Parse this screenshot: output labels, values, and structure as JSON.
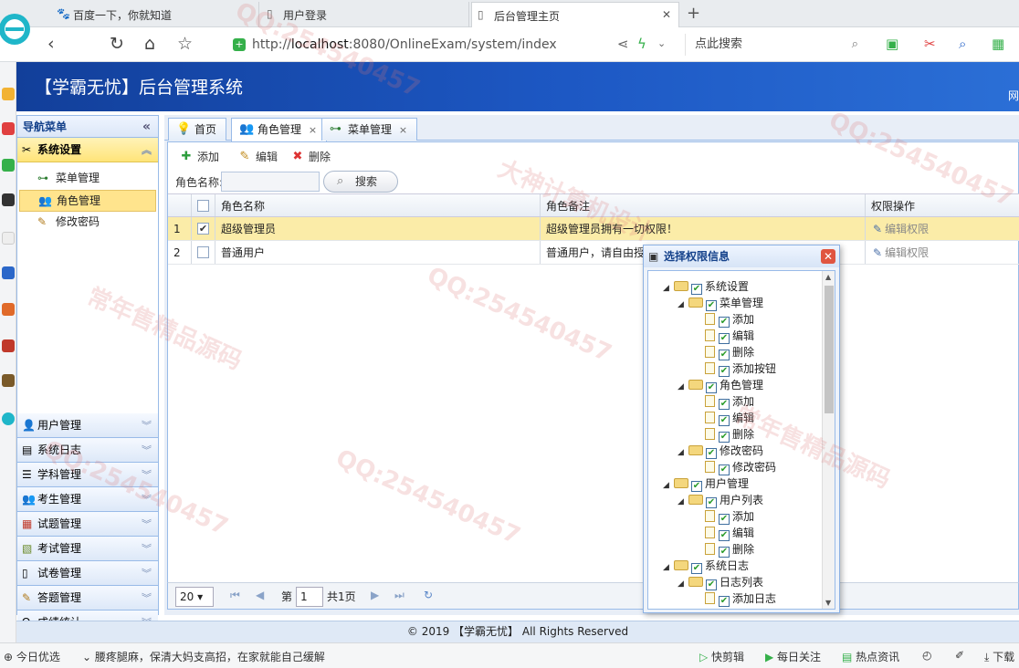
{
  "browser": {
    "tabs": [
      {
        "label": "百度一下，你就知道"
      },
      {
        "label": "用户登录"
      },
      {
        "label": "后台管理主页",
        "close": "✕"
      }
    ],
    "new_tab": "+",
    "url_scheme": "http://",
    "url_host": "localhost",
    "url_rest": ":8080/OnlineExam/system/index",
    "search_placeholder": "点此搜索"
  },
  "app": {
    "title": "【学霸无忧】后台管理系统",
    "header_right": "网"
  },
  "nav": {
    "header": "导航菜单",
    "collapse": "«",
    "sections": [
      {
        "label": "系统设置",
        "open": true
      },
      {
        "label": "用户管理"
      },
      {
        "label": "系统日志"
      },
      {
        "label": "学科管理"
      },
      {
        "label": "考生管理"
      },
      {
        "label": "试题管理"
      },
      {
        "label": "考试管理"
      },
      {
        "label": "试卷管理"
      },
      {
        "label": "答题管理"
      },
      {
        "label": "成绩统计"
      }
    ],
    "sub_items": [
      {
        "label": "菜单管理"
      },
      {
        "label": "角色管理",
        "selected": true
      },
      {
        "label": "修改密码"
      }
    ]
  },
  "main_tabs": [
    {
      "label": "首页"
    },
    {
      "label": "角色管理",
      "close": "×"
    },
    {
      "label": "菜单管理",
      "close": "×"
    }
  ],
  "toolbar": {
    "add": "添加",
    "edit": "编辑",
    "delete": "删除"
  },
  "search": {
    "label": "角色名称:",
    "button": "搜索"
  },
  "table": {
    "columns": [
      "角色名称",
      "角色备注",
      "权限操作"
    ],
    "rows": [
      {
        "num": "1",
        "name": "超级管理员",
        "remark": "超级管理员拥有一切权限！",
        "action": "编辑权限",
        "checked": true
      },
      {
        "num": "2",
        "name": "普通用户",
        "remark": "普通用户，请自由授",
        "action": "编辑权限",
        "checked": false
      }
    ]
  },
  "pager": {
    "page_size": "20",
    "page_prefix": "第",
    "page_value": "1",
    "page_total": "共1页"
  },
  "dialog": {
    "title": "选择权限信息",
    "tree": [
      {
        "label": "系统设置"
      },
      {
        "label": "菜单管理"
      },
      {
        "label": "添加"
      },
      {
        "label": "编辑"
      },
      {
        "label": "删除"
      },
      {
        "label": "添加按钮"
      },
      {
        "label": "角色管理"
      },
      {
        "label": "添加"
      },
      {
        "label": "编辑"
      },
      {
        "label": "删除"
      },
      {
        "label": "修改密码"
      },
      {
        "label": "修改密码"
      },
      {
        "label": "用户管理"
      },
      {
        "label": "用户列表"
      },
      {
        "label": "添加"
      },
      {
        "label": "编辑"
      },
      {
        "label": "删除"
      },
      {
        "label": "系统日志"
      },
      {
        "label": "日志列表"
      },
      {
        "label": "添加日志"
      }
    ]
  },
  "footer": "© 2019 【学霸无忧】 All Rights Reserved",
  "statusbar": {
    "left": "今日优选",
    "news": "腰疼腿麻，保清大妈支高招，在家就能自己缓解",
    "items": [
      "快剪辑",
      "每日关注",
      "热点资讯"
    ],
    "download": "下载"
  },
  "watermarks": [
    "常年售精品源码",
    "QQ:254540457",
    "大神计算机设计"
  ],
  "colors": {
    "header_blue": "#1d58c4",
    "nav_border": "#99bbe8",
    "selected_yellow": "#ffe48d",
    "close_red": "#e05540"
  }
}
